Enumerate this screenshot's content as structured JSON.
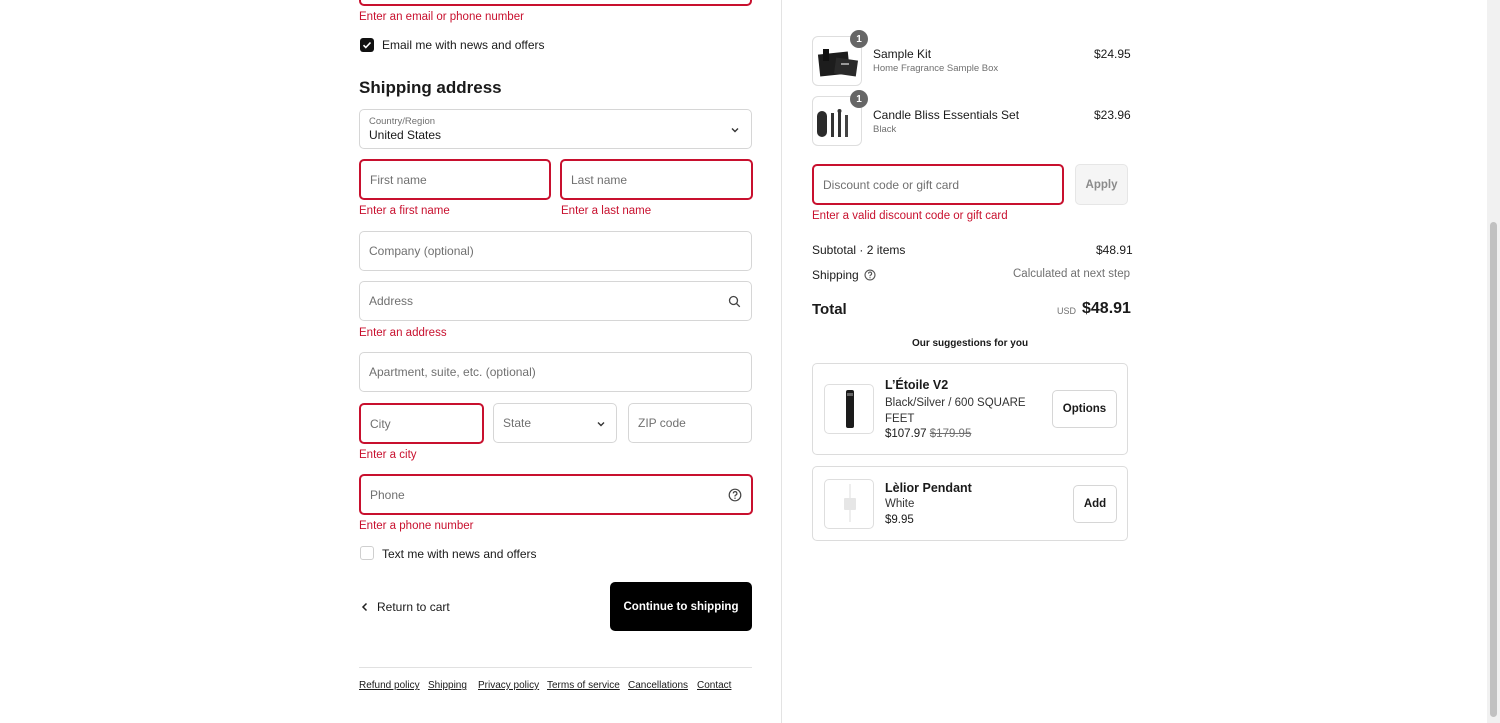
{
  "contact": {
    "email_error": "Enter an email or phone number",
    "newsletter_label": "Email me with news and offers"
  },
  "shipping": {
    "heading": "Shipping address",
    "country_label": "Country/Region",
    "country_value": "United States",
    "first_name_placeholder": "First name",
    "first_name_error": "Enter a first name",
    "last_name_placeholder": "Last name",
    "last_name_error": "Enter a last name",
    "company_placeholder": "Company (optional)",
    "address_placeholder": "Address",
    "address_error": "Enter an address",
    "apartment_placeholder": "Apartment, suite, etc. (optional)",
    "city_placeholder": "City",
    "city_error": "Enter a city",
    "state_placeholder": "State",
    "zip_placeholder": "ZIP code",
    "phone_placeholder": "Phone",
    "phone_error": "Enter a phone number",
    "sms_label": "Text me with news and offers"
  },
  "actions": {
    "return_label": "Return to cart",
    "continue_label": "Continue to shipping"
  },
  "footer": {
    "links": [
      "Refund policy",
      "Shipping",
      "Privacy policy",
      "Terms of service",
      "Cancellations",
      "Contact"
    ]
  },
  "cart": {
    "items": [
      {
        "name": "Sample Kit",
        "variant": "Home Fragrance Sample Box",
        "price": "$24.95",
        "qty": "1"
      },
      {
        "name": "Candle Bliss Essentials Set",
        "variant": "Black",
        "price": "$23.96",
        "qty": "1"
      }
    ],
    "discount_placeholder": "Discount code or gift card",
    "apply_label": "Apply",
    "discount_error": "Enter a valid discount code or gift card",
    "subtotal_label": "Subtotal · 2 items",
    "subtotal_value": "$48.91",
    "shipping_label": "Shipping",
    "shipping_value": "Calculated at next step",
    "total_label": "Total",
    "currency": "USD",
    "total_value": "$48.91"
  },
  "suggestions": {
    "heading": "Our suggestions for you",
    "items": [
      {
        "name": "L’Étoile V2",
        "variant": "Black/Silver / 600 SQUARE FEET",
        "price": "$107.97",
        "compare_price": "$179.95",
        "button": "Options"
      },
      {
        "name": "Lèlior Pendant",
        "variant": "White",
        "price": "$9.95",
        "button": "Add"
      }
    ]
  },
  "colors": {
    "error": "#c8102e",
    "primary_button": "#000000"
  }
}
